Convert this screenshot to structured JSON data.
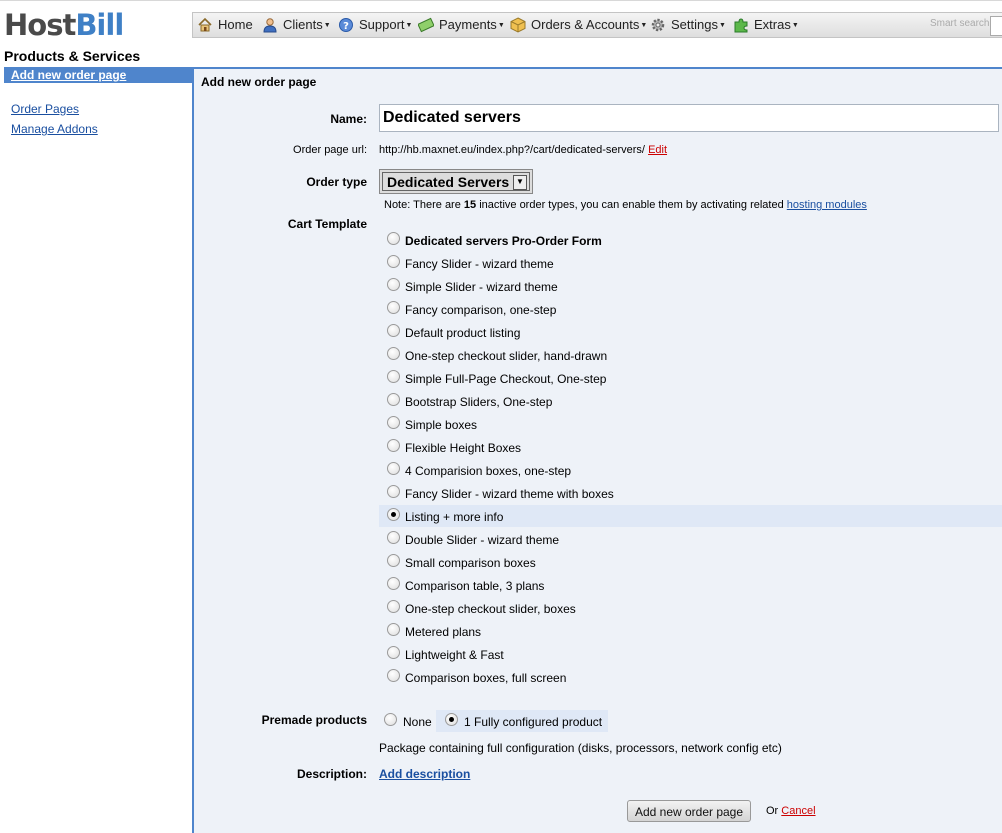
{
  "app": {
    "logo_part1": "Host",
    "logo_part2": "Bill",
    "section_title": "Products & Services"
  },
  "menu": {
    "items": [
      {
        "label": "Home",
        "icon": "home-icon",
        "has_dropdown": false
      },
      {
        "label": "Clients",
        "icon": "user-icon",
        "has_dropdown": true
      },
      {
        "label": "Support",
        "icon": "help-icon",
        "has_dropdown": true
      },
      {
        "label": "Payments",
        "icon": "money-icon",
        "has_dropdown": true
      },
      {
        "label": "Orders & Accounts",
        "icon": "package-icon",
        "has_dropdown": true
      },
      {
        "label": "Settings",
        "icon": "gear-icon",
        "has_dropdown": true
      },
      {
        "label": "Extras",
        "icon": "puzzle-icon",
        "has_dropdown": true
      }
    ],
    "search_placeholder": "Smart search"
  },
  "sidebar": {
    "active": "Add new order page",
    "links": [
      "Order Pages",
      "Manage Addons"
    ]
  },
  "form": {
    "header": "Add new order page",
    "name_label": "Name:",
    "name_value": "Dedicated servers",
    "url_label": "Order page url:",
    "url_value": "http://hb.maxnet.eu/index.php?/cart/dedicated-servers/",
    "url_edit": "Edit",
    "order_type_label": "Order type",
    "order_type_value": "Dedicated Servers",
    "note_prefix": "Note: There are ",
    "note_count": "15",
    "note_suffix": " inactive order types, you can enable them by activating related ",
    "note_link": "hosting modules",
    "cart_template_label": "Cart Template",
    "templates": [
      {
        "label": "Dedicated servers Pro-Order Form",
        "bold": true,
        "selected": false
      },
      {
        "label": "Fancy Slider - wizard theme",
        "selected": false
      },
      {
        "label": "Simple Slider - wizard theme",
        "selected": false
      },
      {
        "label": "Fancy comparison, one-step",
        "selected": false
      },
      {
        "label": "Default product listing",
        "selected": false
      },
      {
        "label": "One-step checkout slider, hand-drawn",
        "selected": false
      },
      {
        "label": "Simple Full-Page Checkout, One-step",
        "selected": false
      },
      {
        "label": "Bootstrap Sliders, One-step",
        "selected": false
      },
      {
        "label": "Simple boxes",
        "selected": false
      },
      {
        "label": "Flexible Height Boxes",
        "selected": false
      },
      {
        "label": "4 Comparision boxes, one-step",
        "selected": false
      },
      {
        "label": "Fancy Slider - wizard theme with boxes",
        "selected": false
      },
      {
        "label": "Listing + more info",
        "selected": true
      },
      {
        "label": "Double Slider - wizard theme",
        "selected": false
      },
      {
        "label": "Small comparison boxes",
        "selected": false
      },
      {
        "label": "Comparison table, 3 plans",
        "selected": false
      },
      {
        "label": "One-step checkout slider, boxes",
        "selected": false
      },
      {
        "label": "Metered plans",
        "selected": false
      },
      {
        "label": "Lightweight & Fast",
        "selected": false
      },
      {
        "label": "Comparison boxes, full screen",
        "selected": false
      }
    ],
    "premade_label": "Premade products",
    "premade_none": "None",
    "premade_option": "1 Fully configured product",
    "package_desc": "Package containing full configuration (disks, processors, network config etc)",
    "description_label": "Description:",
    "add_description": "Add description",
    "submit_label": "Add new order page",
    "or_text": "Or",
    "cancel_label": "Cancel"
  }
}
